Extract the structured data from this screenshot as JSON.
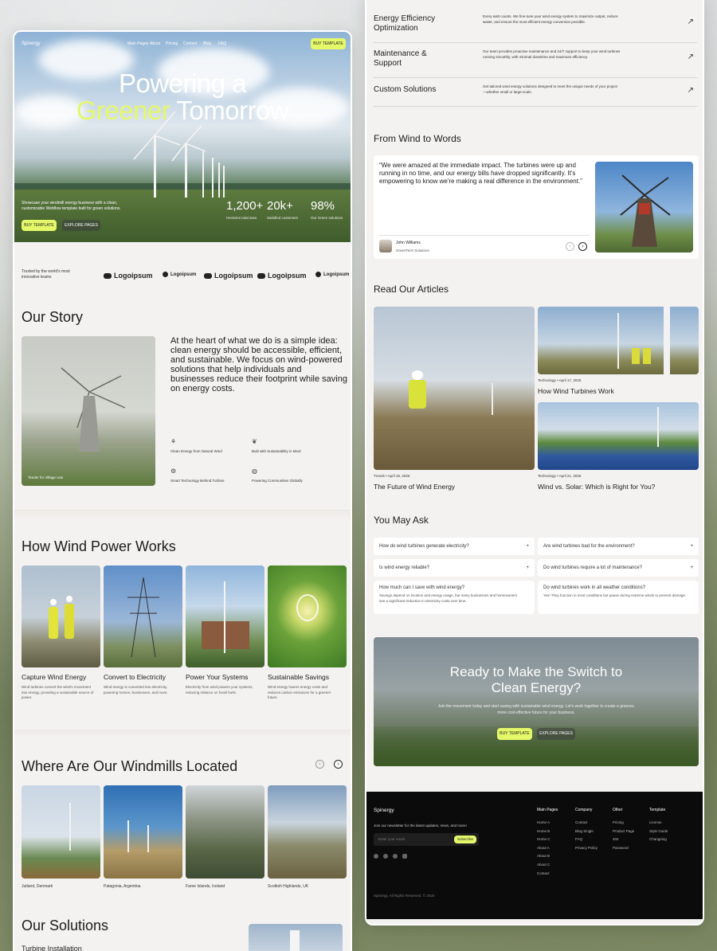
{
  "brand": "Spinergy",
  "nav": [
    "Main Pages",
    "About",
    "Pricing",
    "Contact",
    "Blog",
    "FAQ"
  ],
  "hero": {
    "buy_nav": "BUY TEMPLATE",
    "line1": "Powering a",
    "line2_accent": "Greener",
    "line2_rest": " Tomorrow",
    "desc": "Showcase your windmill energy business with a clean, customizable Webflow template built for green solutions.",
    "buy": "BUY TEMPLATE",
    "explore": "EXPLORE PAGES",
    "stats": [
      {
        "value": "1,200+",
        "label": "Hectares total area"
      },
      {
        "value": "20k+",
        "label": "Satisfied customers"
      },
      {
        "value": "98%",
        "label": "Our Green solutions"
      }
    ]
  },
  "trusted": "Trusted by the world's most innovative teams",
  "logos": [
    "Logoipsum",
    "Logoipsum",
    "Logoipsum",
    "Logoipsum",
    "Logoipsum"
  ],
  "story": {
    "title": "Our Story",
    "text": "At the heart of what we do is a simple idea: clean energy should be accessible, efficient, and sustainable. We focus on wind-powered solutions that help individuals and businesses reduce their footprint while saving on energy costs.",
    "caption": "Tender for Village Use",
    "features": [
      "Clean Energy from Natural Wind",
      "Built with Sustainability in Mind",
      "Smart Technology Behind Turbine",
      "Powering Communities Globally"
    ]
  },
  "how": {
    "title": "How Wind Power Works",
    "steps": [
      {
        "title": "Capture Wind Energy",
        "desc": "Wind turbines convert the wind's movement into energy, providing a sustainable source of power."
      },
      {
        "title": "Convert to Electricity",
        "desc": "Wind energy is converted into electricity, powering homes, businesses, and more."
      },
      {
        "title": "Power Your Systems",
        "desc": "Electricity from wind powers your systems, reducing reliance on fossil fuels."
      },
      {
        "title": "Sustainable Savings",
        "desc": "Wind energy lowers energy costs and reduces carbon emissions for a greener future."
      }
    ]
  },
  "locations": {
    "title": "Where Are Our Windmills Located",
    "items": [
      "Jutland, Denmark",
      "Patagonia, Argentina",
      "Faroe Islands, Iceland",
      "Scottish Highlands, UK"
    ]
  },
  "solutions": {
    "title": "Our Solutions",
    "first": "Turbine Installation",
    "rows": [
      {
        "title": "Energy Efficiency Optimization",
        "desc": "Every watt counts. We fine-tune your wind energy system to maximize output, reduce waste, and ensure the most efficient energy conversion possible."
      },
      {
        "title": "Maintenance & Support",
        "desc": "Our team provides proactive maintenance and 24/7 support to keep your wind turbines running smoothly, with minimal downtime and maximum efficiency."
      },
      {
        "title": "Custom Solutions",
        "desc": "Get tailored wind energy solutions designed to meet the unique needs of your project—whether small or large-scale."
      }
    ]
  },
  "testimonial": {
    "title": "From Wind to Words",
    "quote": "“We were amazed at the immediate impact. The turbines were up and running in no time, and our energy bills have dropped significantly. It's empowering to know we're making a real difference in the environment.”",
    "name": "John Williams",
    "company": "GreenTech Solutions"
  },
  "articles": {
    "title": "Read Our Articles",
    "items": [
      {
        "meta": "Trends • April 19, 2025",
        "title": "The Future of Wind Energy"
      },
      {
        "meta": "Technology • April 17, 2025",
        "title": "How Wind Turbines Work"
      },
      {
        "meta": "Technology • April 21, 2025",
        "title": "Wind vs. Solar: Which is Right for You?"
      }
    ]
  },
  "faq": {
    "title": "You May Ask",
    "items": [
      "How do wind turbines generate electricity?",
      "Are wind turbines bad for the environment?",
      "Is wind energy reliable?",
      "Do wind turbines require a lot of maintenance?"
    ],
    "open": [
      {
        "q": "How much can I save with wind energy?",
        "a": "Savings depend on location and energy usage, but many businesses and homeowners see a significant reduction in electricity costs over time."
      },
      {
        "q": "Do wind turbines work in all weather conditions?",
        "a": "Yes! They function in most conditions but pause during extreme winds to prevent damage."
      }
    ]
  },
  "cta": {
    "title": "Ready to Make the Switch to Clean Energy?",
    "desc": "Join the movement today and start saving with sustainable wind energy. Let's work together to create a greener, more cost-effective future for your business.",
    "buy": "BUY TEMPLATE",
    "explore": "EXPLORE PAGES"
  },
  "footer": {
    "brand": "Spinergy",
    "newsletter": "Join our newsletter for the latest updates, news, and more!",
    "placeholder": "Enter your email",
    "subscribe": "Subscribe",
    "cols": [
      {
        "title": "Main Pages",
        "links": [
          "Home A",
          "Home B",
          "Home C",
          "About A",
          "About B",
          "About C",
          "Contact"
        ]
      },
      {
        "title": "Company",
        "links": [
          "Contact",
          "Blog Single",
          "FAQ",
          "Privacy Policy"
        ]
      },
      {
        "title": "Other",
        "links": [
          "Pricing",
          "Product Page",
          "404",
          "Password"
        ]
      },
      {
        "title": "Template",
        "links": [
          "License",
          "Style Guide",
          "Changelog"
        ]
      }
    ],
    "copyright": "Spinergy. All Rights Reserved. © 2025"
  }
}
